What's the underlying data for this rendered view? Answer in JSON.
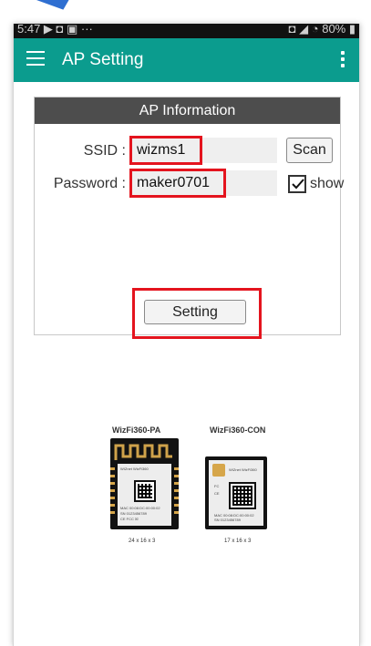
{
  "status_bar": {
    "left_text": "5:47 ▶ ◘ ▣ ···",
    "right_text": "◘ ◢ ◔ 80% ▮"
  },
  "app_bar": {
    "title": "AP Setting",
    "menu_icon": "hamburger-menu-icon",
    "overflow_icon": "overflow-menu-icon"
  },
  "card": {
    "header": "AP Information",
    "ssid_label": "SSID :",
    "ssid_value": "wizms1",
    "password_label": "Password :",
    "password_value": "maker0701",
    "scan_label": "Scan",
    "show_label": "show",
    "show_checked": true,
    "setting_label": "Setting"
  },
  "products": [
    {
      "name": "WizFi360-PA",
      "dimensions": "24 x 16 x 3",
      "brand": "WIZnet WizFi360"
    },
    {
      "name": "WizFi360-CON",
      "dimensions": "17 x 16 x 3",
      "brand": "WIZnet WizFi360"
    }
  ],
  "colors": {
    "app_bar": "#0b9c8e",
    "card_header": "#4d4d4d",
    "highlight": "#e4141e"
  }
}
